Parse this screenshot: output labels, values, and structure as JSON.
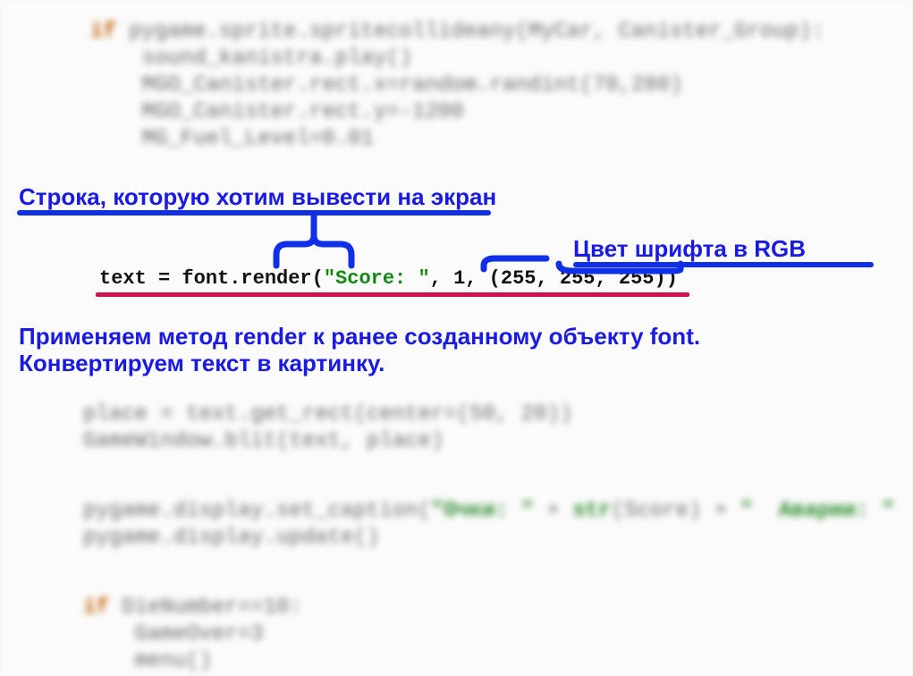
{
  "annotations": {
    "string_to_output": "Строка, которую хотим вывести на экран",
    "font_color_rgb": "Цвет шрифта в RGB",
    "render_explain_line1": "Применяем метод render к ранее созданному объекту font.",
    "render_explain_line2": "Конвертируем текст в картинку."
  },
  "code": {
    "sharp_prefix": "text = font.render(",
    "sharp_string": "\"Score: \"",
    "sharp_suffix": ", 1, (255, 255, 255))",
    "blur_block1_line1_kw": "if",
    "blur_block1_line1_rest": " pygame.sprite.spritecollideany(MyCar, Canister_Group):",
    "blur_block1_line2": "    sound_kanistra.play()",
    "blur_block1_line3": "    MGO_Canister.rect.x=random.randint(70,280)",
    "blur_block1_line4": "    MGO_Canister.rect.y=-1200",
    "blur_block1_line5": "    MG_Fuel_Level=0.01",
    "blur_block2_line1": "place = text.get_rect(center=(50, 20))",
    "blur_block2_line2": "GameWindow.blit(text, place)",
    "blur_block3_line1_a": "pygame.display.set_caption(",
    "blur_block3_line1_str1": "\"Очки: \"",
    "blur_block3_line1_b": " + ",
    "blur_block3_line1_strfn": "str",
    "blur_block3_line1_c": "(Score) + ",
    "blur_block3_line1_str2": "\"  Аварии: \"",
    "blur_block3_line2": "pygame.display.update()",
    "blur_block4_line1_kw": "if",
    "blur_block4_line1_rest": " DieNumber==10:",
    "blur_block4_line2": "    GameOver=3",
    "blur_block4_line3": "    menu()"
  }
}
